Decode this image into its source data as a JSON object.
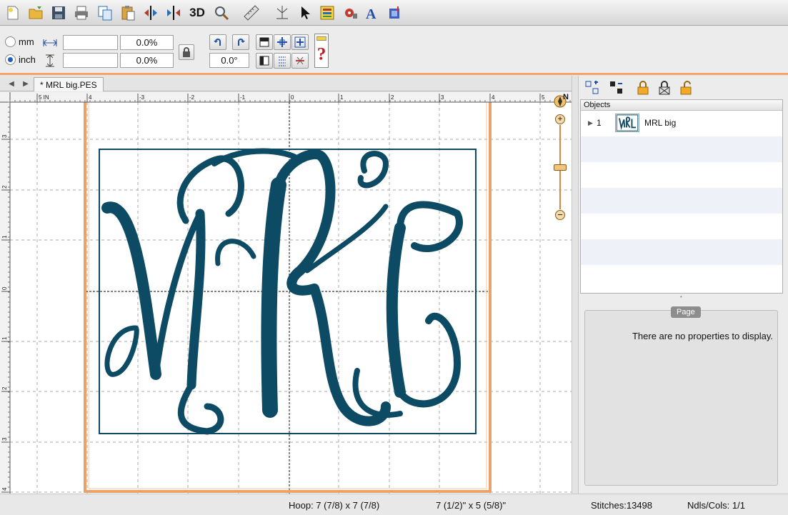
{
  "toolbar": {
    "buttons": [
      "new-icon",
      "open-icon",
      "save-icon",
      "print-icon",
      "copy-icon",
      "paste-icon",
      "mirror-horizontal-icon",
      "mirror-vertical-icon",
      "3d-view-icon",
      "zoom-icon",
      "ruler-icon",
      "stitch-simulator-icon",
      "select-arrow-icon",
      "color-sort-icon",
      "settings-icon",
      "text-icon",
      "fabric-icon"
    ],
    "label_3d": "3D"
  },
  "units": {
    "mm_label": "mm",
    "inch_label": "inch",
    "selected": "inch"
  },
  "size": {
    "width_value": "",
    "height_value": "",
    "width_percent": "0.0%",
    "height_percent": "0.0%"
  },
  "rotation": {
    "value": "0.0°"
  },
  "document": {
    "tab_label": "* MRL big.PES"
  },
  "rulers": {
    "top_ticks": [
      {
        "label": "5 IN"
      },
      {
        "label": "4"
      },
      {
        "label": "-3"
      },
      {
        "label": "-2"
      },
      {
        "label": "-1"
      },
      {
        "label": "0"
      },
      {
        "label": "1"
      },
      {
        "label": "2"
      },
      {
        "label": "3"
      },
      {
        "label": "4"
      },
      {
        "label": "5"
      }
    ],
    "left_ticks": [
      {
        "label": "3"
      },
      {
        "label": "2"
      },
      {
        "label": "1"
      },
      {
        "label": "0"
      },
      {
        "label": "1"
      },
      {
        "label": "2"
      },
      {
        "label": "3"
      },
      {
        "label": "4"
      }
    ]
  },
  "design": {
    "monogram_letters": "MRL",
    "thread_color": "#0d4a63",
    "border_color": "#0d4a63"
  },
  "compass_label": "N",
  "objects_panel": {
    "header": "Objects",
    "items": [
      {
        "index": "1",
        "name": "MRL big"
      }
    ]
  },
  "page_panel": {
    "tab": "Page",
    "message": "There are no properties to display."
  },
  "status": {
    "hoop": "Hoop: 7 (7/8) x 7 (7/8)",
    "design_size": "7 (1/2)\" x 5 (5/8)\"",
    "stitches": "Stitches:13498",
    "needles": "Ndls/Cols: 1/1"
  },
  "colors": {
    "hoop_orange": "#e9a26a",
    "accent_blue": "#1f5fbf"
  }
}
